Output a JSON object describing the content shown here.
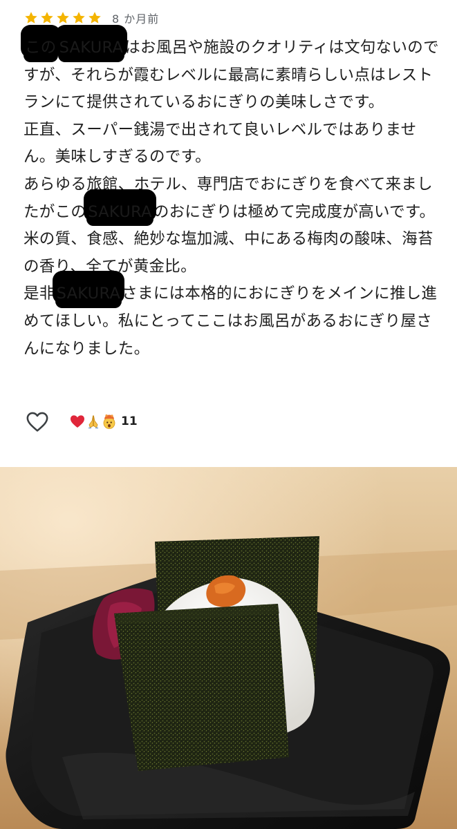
{
  "review": {
    "rating": 5,
    "date": "8 か月前",
    "paragraphs": [
      {
        "segments": [
          {
            "text": "この",
            "redacted": true
          },
          {
            "text": "SAKURA",
            "redacted": true
          },
          {
            "text": "はお風呂や施設のクオリティは文句ないのですが、それらが霞むレベルに最高に素晴らしい点はレストランにて提供されているおにぎりの美味しさです。",
            "redacted": false
          }
        ]
      },
      {
        "segments": [
          {
            "text": "正直、スーパー銭湯で出されて良いレベルではありません。美味しすぎるのです。",
            "redacted": false
          }
        ]
      },
      {
        "segments": [
          {
            "text": "あらゆる旅館、ホテル、専門店でおにぎりを食べて来ましたがこの",
            "redacted": false
          },
          {
            "text": "SAKURA",
            "redacted": true
          },
          {
            "text": "のおにぎりは極めて完成度が高いです。",
            "redacted": false
          }
        ]
      },
      {
        "segments": [
          {
            "text": "米の質、食感、絶妙な塩加減、中にある梅肉の酸味、海苔の香り、全てが黄金比。",
            "redacted": false
          }
        ]
      },
      {
        "segments": [
          {
            "text": "是非",
            "redacted": false
          },
          {
            "text": "SAKURA",
            "redacted": true
          },
          {
            "text": "さまには本格的におにぎりをメインに推し進めてほしい。私にとってここはお風呂があるおにぎり屋さんになりました。",
            "redacted": false
          }
        ]
      }
    ],
    "reactions": {
      "icons": [
        "red-heart-icon",
        "folded-hands-icon",
        "exploding-head-icon"
      ],
      "count": "11"
    }
  },
  "colors": {
    "star": "#f4b400",
    "date_text": "#5f6368",
    "body_text": "#1f1f1f",
    "redaction": "#000000"
  },
  "photo": {
    "subject": "onigiri-with-umeboshi-on-black-plate-icon"
  }
}
